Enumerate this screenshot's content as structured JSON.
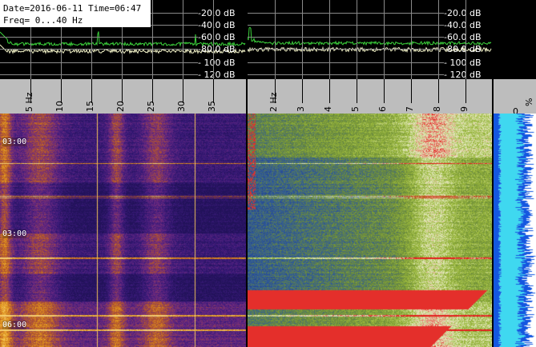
{
  "info": {
    "date_line": "Date=2016-06-11 Time=06:47",
    "freq_line": "Freq= 0...40 Hz"
  },
  "db_labels": [
    "-20.0 dB",
    "-40.0 dB",
    "-60.0 dB",
    "-80.0 dB",
    "- 100 dB",
    "- 120 dB"
  ],
  "left_axis": {
    "ticks": [
      "5 Hz",
      "10",
      "15",
      "20",
      "25",
      "30",
      "35"
    ]
  },
  "mid_axis": {
    "ticks": [
      "2 Hz",
      "3",
      "4",
      "5",
      "6",
      "7",
      "8",
      "9"
    ]
  },
  "right_axis": {
    "label_zero": "0",
    "label_pct": "%"
  },
  "time_labels": [
    "03:00",
    "03:00",
    "06:00"
  ],
  "colors": {
    "left_cmap": [
      "#22125a",
      "#3a1a7a",
      "#6e2a80",
      "#b4552a",
      "#e49a1e",
      "#f7d070"
    ],
    "mid_cmap": [
      "#1f3a8a",
      "#2f5a9a",
      "#6a8a3a",
      "#9ab83a",
      "#e8ecc8",
      "#e41a1a"
    ],
    "bar_dark": "#1457e0",
    "bar_light": "#3fd8f0"
  }
}
